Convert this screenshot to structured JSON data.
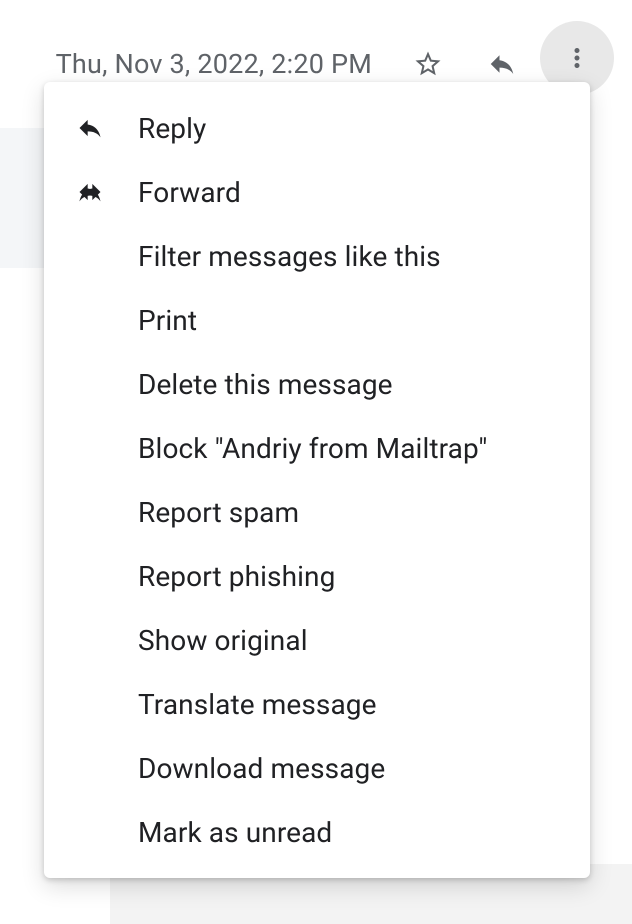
{
  "header": {
    "timestamp": "Thu, Nov 3, 2022, 2:20 PM"
  },
  "menu": {
    "items": [
      {
        "icon": "reply",
        "label": "Reply"
      },
      {
        "icon": "forward",
        "label": "Forward"
      },
      {
        "icon": "",
        "label": "Filter messages like this"
      },
      {
        "icon": "",
        "label": "Print"
      },
      {
        "icon": "",
        "label": "Delete this message"
      },
      {
        "icon": "",
        "label": "Block \"Andriy from Mailtrap\""
      },
      {
        "icon": "",
        "label": "Report spam"
      },
      {
        "icon": "",
        "label": "Report phishing"
      },
      {
        "icon": "",
        "label": "Show original"
      },
      {
        "icon": "",
        "label": "Translate message"
      },
      {
        "icon": "",
        "label": "Download message"
      },
      {
        "icon": "",
        "label": "Mark as unread"
      }
    ]
  }
}
